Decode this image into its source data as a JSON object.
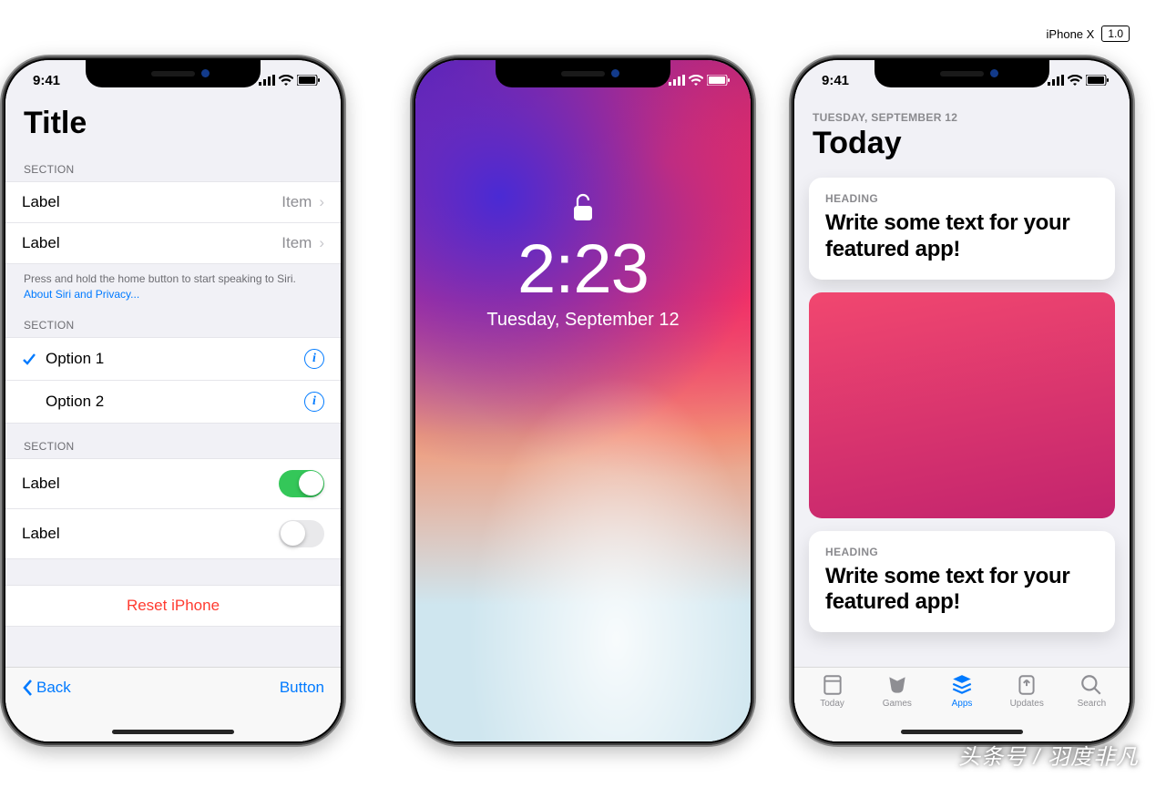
{
  "meta": {
    "device": "iPhone X",
    "version": "1.0"
  },
  "watermark": "头条号 / 羽度非凡",
  "status_time": "9:41",
  "lock": {
    "time": "2:23",
    "date": "Tuesday, September 12"
  },
  "today": {
    "date_label": "TUESDAY, SEPTEMBER 12",
    "title": "Today",
    "card1_heading": "HEADING",
    "card1_text": "Write some text for your featured app!",
    "card2_heading": "HEADING",
    "card2_text": "Write some text for your featured app!",
    "tabs": {
      "today": "Today",
      "games": "Games",
      "apps": "Apps",
      "updates": "Updates",
      "search": "Search"
    }
  },
  "settings": {
    "title": "Title",
    "section1": {
      "header": "SECTION",
      "row1_label": "Label",
      "row1_value": "Item",
      "row2_label": "Label",
      "row2_value": "Item",
      "footer_text": "Press and hold the home button to start speaking to Siri. ",
      "footer_link": "About Siri and Privacy..."
    },
    "section2": {
      "header": "SECTION",
      "option1": "Option 1",
      "option2": "Option 2"
    },
    "section3": {
      "header": "SECTION",
      "row1_label": "Label",
      "row2_label": "Label",
      "reset": "Reset iPhone"
    },
    "toolbar": {
      "back": "Back",
      "button": "Button"
    }
  }
}
